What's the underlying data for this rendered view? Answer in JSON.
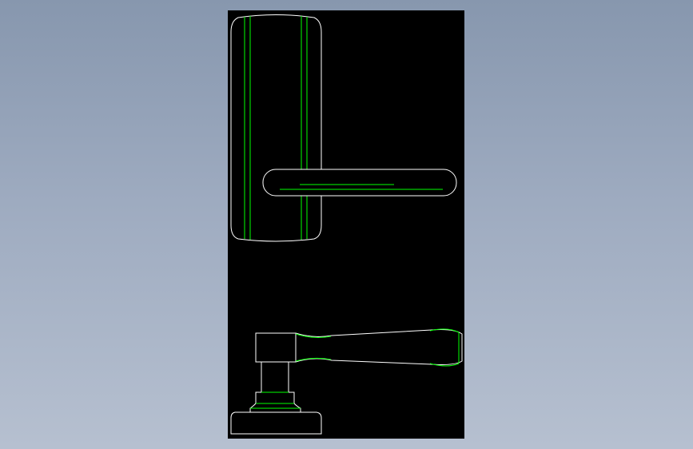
{
  "background": {
    "gradient_top": "#8797ae",
    "gradient_bottom": "#b6c0d0"
  },
  "sheet": {
    "fill": "#000000"
  },
  "colors": {
    "outline": "#ffffff",
    "centerline": "#00ff00"
  },
  "views": [
    {
      "name": "front-view",
      "description_text": ""
    },
    {
      "name": "side-view",
      "description_text": ""
    }
  ]
}
